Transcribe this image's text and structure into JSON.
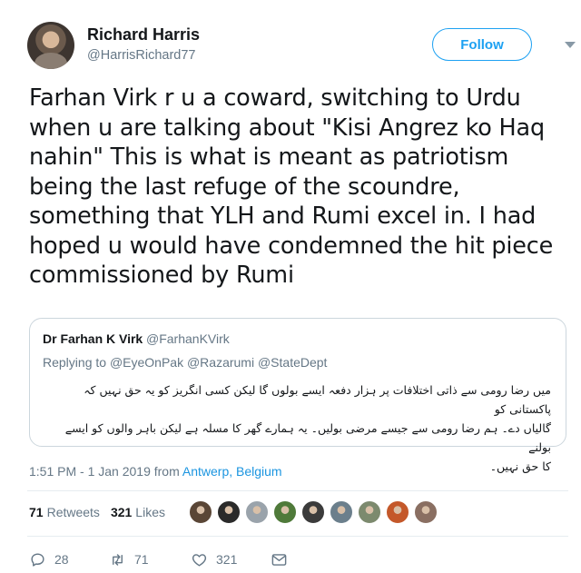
{
  "author": {
    "name": "Richard Harris",
    "handle": "@HarrisRichard77",
    "follow_label": "Follow"
  },
  "tweet": {
    "lines": [
      "Farhan Virk r u a coward, switching to Urdu",
      "when u are talking about \"Kisi Angrez ko Haq",
      "nahin\"  This is what is meant as patriotism",
      "being the last refuge of the scoundre,",
      "something that YLH and Rumi excel in. I had",
      "hoped u would have condemned the hit piece",
      "commissioned by Rumi"
    ]
  },
  "quoted": {
    "name": "Dr Farhan K Virk",
    "handle": "@FarhanKVirk",
    "reply_prefix": "Replying to",
    "reply_mentions": "@EyeOnPak @Razarumi @StateDept",
    "body_lines": [
      "میں رضا رومی سے ذاتی اختلافات پر ہزار دفعہ ایسے بولوں گا لیکن کسی انگریز کو یہ حق نہیں کہ پاکستانی کو",
      "گالیاں دے۔ ہم رضا رومی سے جیسے مرضی بولیں۔ یہ ہمارے گھر کا مسلہ ہے لیکن باہر والوں کو ایسے بولنے",
      "کا حق نہیں۔"
    ]
  },
  "timestamp": {
    "time": "1:51 PM - 1 Jan 2019 from ",
    "location": "Antwerp, Belgium"
  },
  "stats": {
    "retweets_count": "71",
    "retweets_label": "Retweets",
    "likes_count": "321",
    "likes_label": "Likes"
  },
  "likers": [
    {
      "icon": "liker-avatar",
      "color": "#5a4636"
    },
    {
      "icon": "liker-avatar",
      "color": "#2a2a2a"
    },
    {
      "icon": "liker-avatar",
      "color": "#9aa3ab"
    },
    {
      "icon": "liker-avatar",
      "color": "#4f7a3a"
    },
    {
      "icon": "liker-avatar",
      "color": "#3b3b3b"
    },
    {
      "icon": "liker-avatar",
      "color": "#6b7f8c"
    },
    {
      "icon": "liker-avatar",
      "color": "#7c8a6e"
    },
    {
      "icon": "liker-avatar",
      "color": "#c4582a"
    },
    {
      "icon": "liker-avatar",
      "color": "#8a6f62"
    }
  ],
  "actions": {
    "replies": "28",
    "retweets": "71",
    "likes": "321"
  },
  "colors": {
    "accent": "#1da1f2",
    "link": "#1b95e0",
    "muted": "#657786"
  }
}
